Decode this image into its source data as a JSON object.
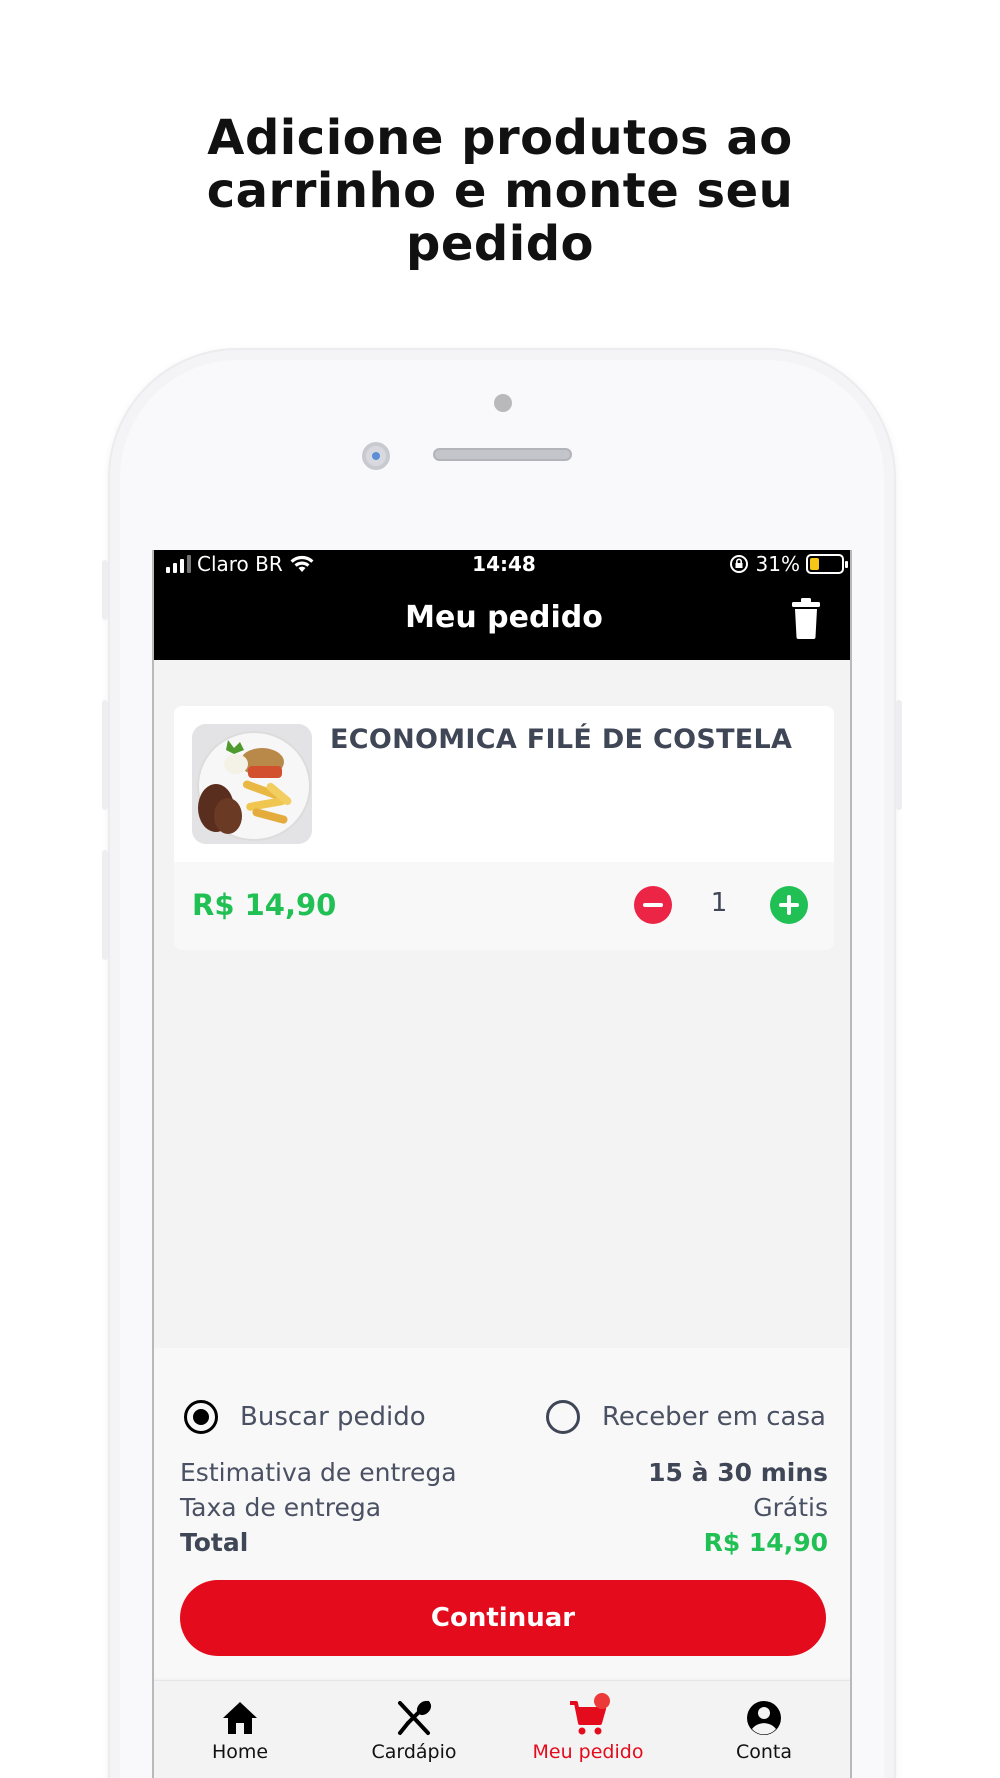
{
  "headline": {
    "line1": "Adicione produtos ao",
    "line2": "carrinho e monte seu",
    "line3": "pedido"
  },
  "status_bar": {
    "carrier": "Claro BR",
    "time": "14:48",
    "battery": "31%",
    "battery_level": 0.31
  },
  "header": {
    "title": "Meu pedido",
    "trash_icon": "trash-icon"
  },
  "cart_item": {
    "name": "ECONOMICA FILÉ DE COSTELA",
    "price": "R$ 14,90",
    "quantity": "1",
    "image_icon": "food-plate-image"
  },
  "delivery_options": {
    "pickup_label": "Buscar pedido",
    "home_label": "Receber em casa",
    "selected": "pickup"
  },
  "summary": {
    "estimate_label": "Estimativa de entrega",
    "estimate_value": "15 à 30 mins",
    "fee_label": "Taxa de entrega",
    "fee_value": "Grátis",
    "total_label": "Total",
    "total_value": "R$ 14,90"
  },
  "continue_label": "Continuar",
  "tabs": [
    {
      "label": "Home",
      "icon": "home-icon"
    },
    {
      "label": "Cardápio",
      "icon": "utensils-icon"
    },
    {
      "label": "Meu pedido",
      "icon": "cart-icon"
    },
    {
      "label": "Conta",
      "icon": "account-icon"
    }
  ],
  "colors": {
    "accent_red": "#e40b1c",
    "price_green": "#21c055",
    "minus_red": "#ec2446",
    "header_black": "#000000"
  }
}
